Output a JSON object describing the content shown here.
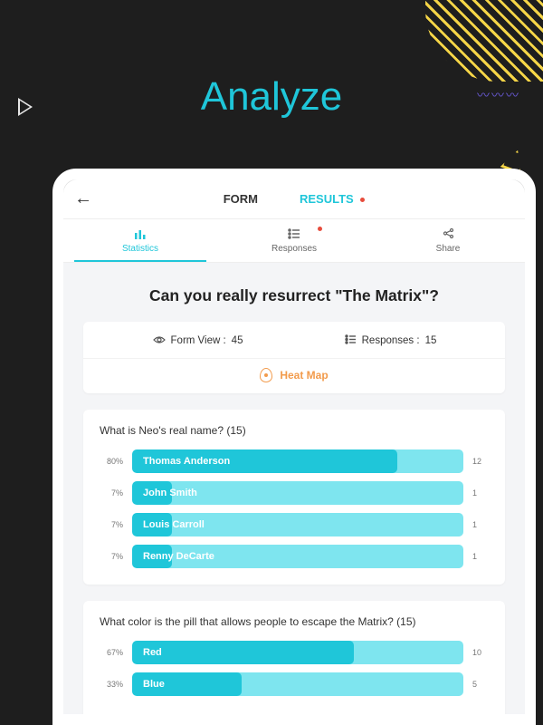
{
  "header": {
    "title": "Analyze"
  },
  "topnav": {
    "tabs": [
      {
        "label": "FORM",
        "active": false,
        "hasDot": false
      },
      {
        "label": "RESULTS",
        "active": true,
        "hasDot": true
      }
    ]
  },
  "subtabs": [
    {
      "label": "Statistics",
      "icon": "bar-chart-icon",
      "active": true,
      "hasDot": false
    },
    {
      "label": "Responses",
      "icon": "list-icon",
      "active": false,
      "hasDot": true
    },
    {
      "label": "Share",
      "icon": "share-icon",
      "active": false,
      "hasDot": false
    }
  ],
  "page": {
    "title": "Can you really resurrect \"The Matrix\"?"
  },
  "stats": {
    "formView": {
      "label": "Form View :",
      "value": "45"
    },
    "responses": {
      "label": "Responses :",
      "value": "15"
    },
    "heatmap": "Heat Map"
  },
  "chart_data": [
    {
      "type": "bar",
      "title": "What is Neo's real name? (15)",
      "xlabel": "",
      "ylabel": "",
      "categories": [
        "Thomas Anderson",
        "John Smith",
        "Louis Carroll",
        "Renny DeCarte"
      ],
      "series": [
        {
          "name": "percent",
          "values": [
            80,
            7,
            7,
            7
          ]
        },
        {
          "name": "count",
          "values": [
            12,
            1,
            1,
            1
          ]
        }
      ],
      "xlim": [
        0,
        100
      ]
    },
    {
      "type": "bar",
      "title": "What color is the pill that allows people to escape the Matrix? (15)",
      "xlabel": "",
      "ylabel": "",
      "categories": [
        "Red",
        "Blue"
      ],
      "series": [
        {
          "name": "percent",
          "values": [
            67,
            33
          ]
        },
        {
          "name": "count",
          "values": [
            10,
            5
          ]
        }
      ],
      "xlim": [
        0,
        100
      ]
    }
  ]
}
